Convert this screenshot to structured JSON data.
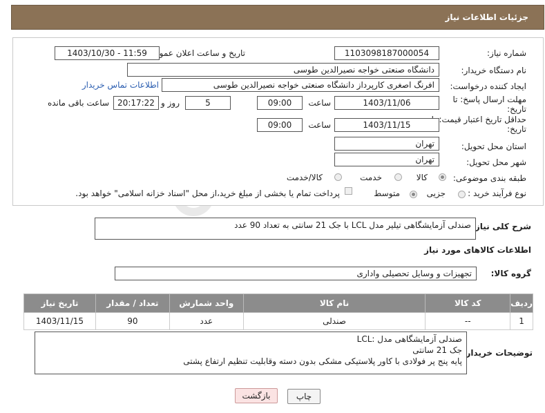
{
  "header": {
    "title": "جزئیات اطلاعات نیاز"
  },
  "fields": {
    "need_number_label": "شماره نیاز:",
    "need_number": "1103098187000054",
    "announce_label": "تاریخ و ساعت اعلان عمومی:",
    "announce_value": "1403/10/30 - 11:59",
    "buyer_org_label": "نام دستگاه خریدار:",
    "buyer_org": "دانشگاه صنعتی خواجه نصیرالدین طوسی",
    "creator_label": "ایجاد کننده درخواست:",
    "creator": "افرنگ اصغری کارپرداز دانشگاه صنعتی خواجه نصیرالدین طوسی",
    "buyer_contact_link": "اطلاعات تماس خریدار",
    "deadline_label_1": "مهلت ارسال پاسخ: تا",
    "deadline_label_2": "تاریخ:",
    "deadline_date": "1403/11/06",
    "time_label": "ساعت",
    "deadline_time": "09:00",
    "days_value": "5",
    "days_label": "روز و",
    "remaining_time": "20:17:22",
    "remaining_label": "ساعت باقی مانده",
    "validity_label_1": "حداقل تاریخ اعتبار قیمت: تا",
    "validity_label_2": "تاریخ:",
    "validity_date": "1403/11/15",
    "validity_time": "09:00",
    "province_label": "استان محل تحویل:",
    "province": "تهران",
    "city_label": "شهر محل تحویل:",
    "city": "تهران",
    "category_label": "طبقه بندی موضوعی:",
    "category_options": [
      "کالا",
      "خدمت",
      "کالا/خدمت"
    ],
    "category_selected": "کالا",
    "process_label": "نوع فرآیند خرید :",
    "process_options": [
      "جزیی",
      "متوسط"
    ],
    "payment_note": "پرداخت تمام یا بخشی از مبلغ خرید،از محل \"اسناد خزانه اسلامی\" خواهد بود."
  },
  "description": {
    "label": "شرح کلی نیاز:",
    "text": "صندلی آزمایشگاهی تیلیر مدل LCL با جک 21 سانتی  به تعداد 90 عدد"
  },
  "goods_section": {
    "title": "اطلاعات کالاهای مورد نیاز",
    "group_label": "گروه کالا:",
    "group_value": "تجهیزات و وسایل تحصیلی واداری"
  },
  "table": {
    "headers": [
      "ردیف",
      "کد کالا",
      "نام کالا",
      "واحد شمارش",
      "تعداد / مقدار",
      "تاریخ نیاز"
    ],
    "rows": [
      [
        "1",
        "--",
        "صندلی",
        "عدد",
        "90",
        "1403/11/15"
      ]
    ]
  },
  "buyer_notes": {
    "label": "توضیحات خریدار:",
    "lines": [
      "صندلی آزمایشگاهی مدل :LCL",
      "جک 21 سانتی",
      "پایه پنج پر فولادی با کاور پلاستیکی مشکی بدون دسته وقابلیت تنظیم ارتفاع پشتی"
    ]
  },
  "buttons": {
    "print": "چاپ",
    "back": "بازگشت"
  },
  "watermark": "AriaTender.neT",
  "colors": {
    "header_bg": "#8b7256",
    "table_header_bg": "#8c8c8c",
    "back_button_bg": "#fbe3e3",
    "link": "#2a5db0"
  }
}
